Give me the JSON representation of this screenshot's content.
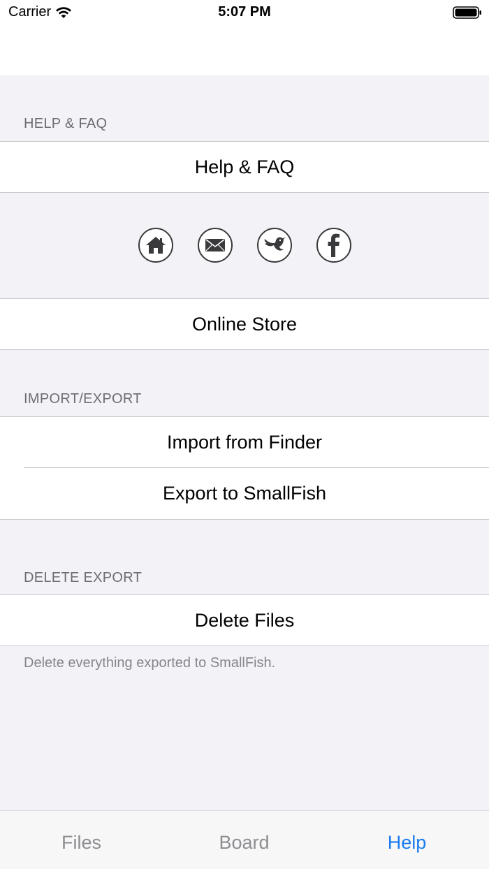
{
  "status_bar": {
    "carrier": "Carrier",
    "time": "5:07 PM"
  },
  "sections": {
    "help_header": "HELP & FAQ",
    "help_row": "Help & FAQ",
    "store_row": "Online Store",
    "import_header": "IMPORT/EXPORT",
    "import_row": "Import from Finder",
    "export_row": "Export to SmallFish",
    "delete_header": "DELETE EXPORT",
    "delete_row": "Delete Files",
    "delete_footer": "Delete everything exported to SmallFish."
  },
  "social_icons": [
    "home-icon",
    "mail-icon",
    "twitter-icon",
    "facebook-icon"
  ],
  "tabs": [
    {
      "label": "Files"
    },
    {
      "label": "Board"
    },
    {
      "label": "Help"
    }
  ],
  "colors": {
    "accent": "#1a7cf0",
    "background": "#f2f2f7",
    "secondary_text": "#6d6d72"
  }
}
